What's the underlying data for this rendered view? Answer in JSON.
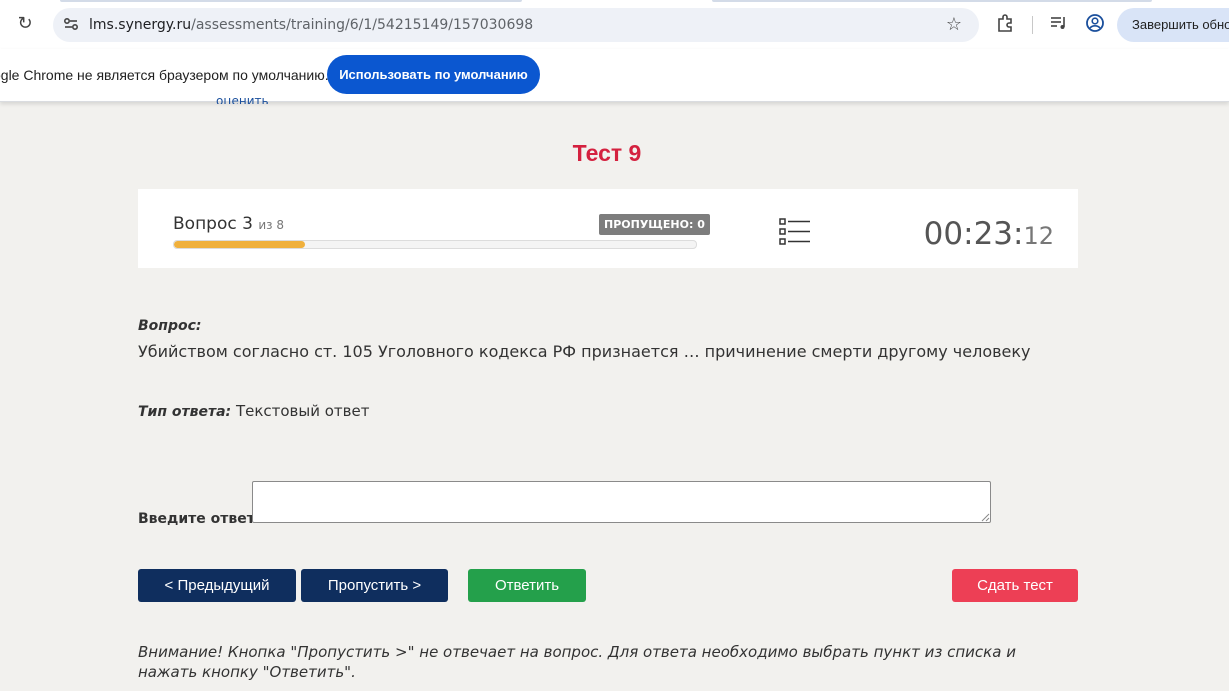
{
  "browser": {
    "url_host": "lms.synergy.ru",
    "url_path": "/assessments/training/6/1/54215149/157030698",
    "update_button": "Завершить обнов",
    "icons": [
      "reload-icon",
      "site-settings-icon",
      "bookmark-star-icon",
      "extensions-icon",
      "media-controls-icon",
      "profile-icon"
    ]
  },
  "infobar": {
    "text": "ogle Chrome не является браузером по умолчанию.",
    "button": "Использовать по умолчанию",
    "peek_link": "оценить"
  },
  "test": {
    "title": "Тест 9",
    "question_label": "Вопрос 3",
    "question_of": "из 8",
    "skipped_badge": "ПРОПУЩЕНО: 0",
    "progress_fraction": 0.25,
    "timer_main": "00:23:",
    "timer_seconds": "12",
    "accent_color": "#d4213f"
  },
  "question": {
    "label": "Вопрос:",
    "text": "Убийством согласно ст. 105 Уголовного кодекса РФ признается … причинение смерти другому человеку",
    "type_label": "Тип ответа:",
    "type_value": "Текстовый ответ"
  },
  "answer": {
    "label": "Введите ответ:",
    "value": ""
  },
  "buttons": {
    "prev": "< Предыдущий",
    "skip": "Пропустить >",
    "answer": "Ответить",
    "submit": "Сдать тест"
  },
  "notice": "Внимание! Кнопка \"Пропустить >\" не отвечает на вопрос. Для ответа необходимо выбрать пункт из списка и нажать кнопку \"Ответить\"."
}
